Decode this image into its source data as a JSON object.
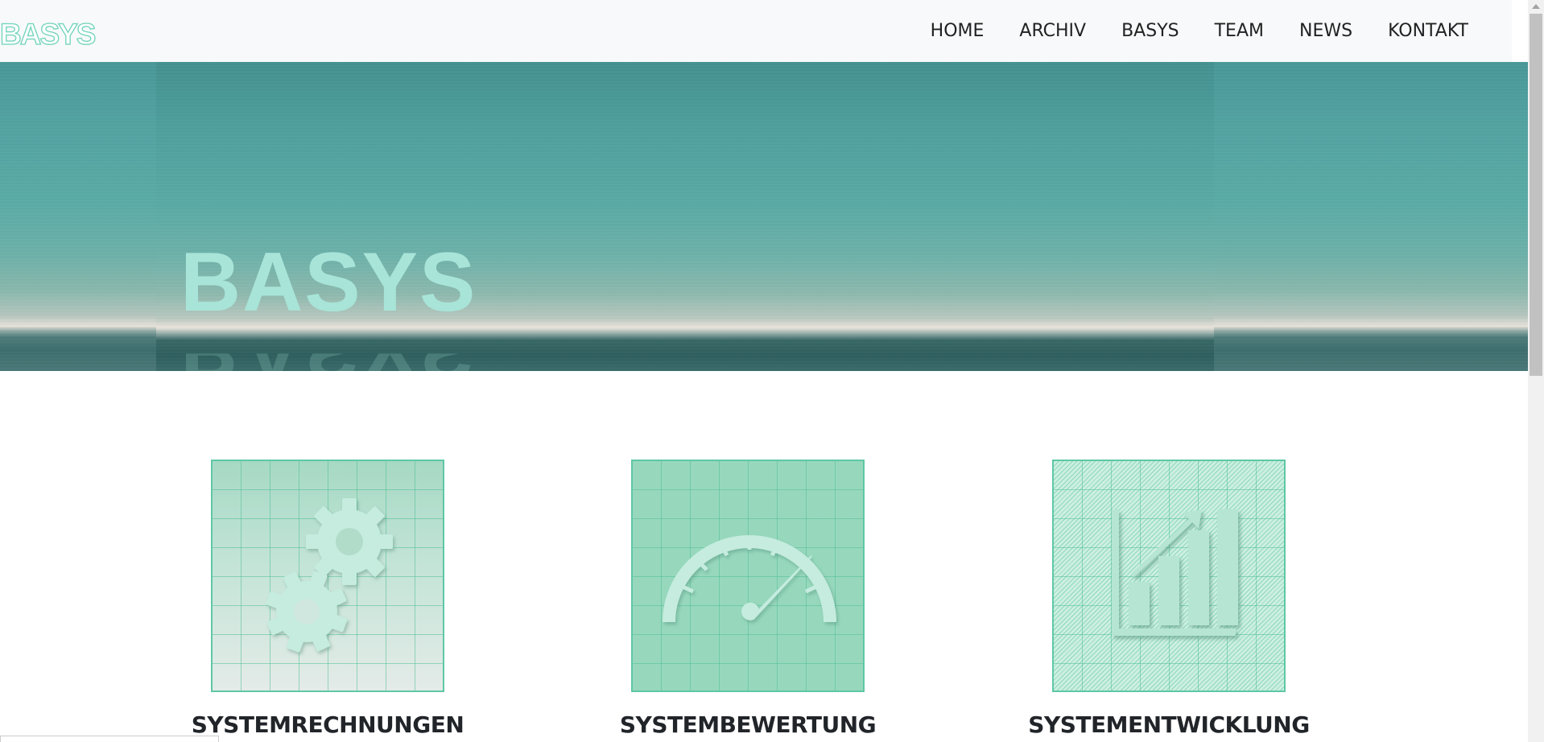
{
  "brand": {
    "logo_text": "BASYS"
  },
  "nav": {
    "items": [
      {
        "label": "HOME"
      },
      {
        "label": "ARCHIV"
      },
      {
        "label": "BASYS"
      },
      {
        "label": "TEAM"
      },
      {
        "label": "NEWS"
      },
      {
        "label": "KONTAKT"
      }
    ]
  },
  "hero": {
    "title": "BASYS"
  },
  "services": [
    {
      "title": "SYSTEMRECHNUNGEN",
      "icon": "gears-icon"
    },
    {
      "title": "SYSTEMBEWERTUNG",
      "icon": "speedometer-icon"
    },
    {
      "title": "SYSTEMENTWICKLUNG",
      "icon": "growth-chart-icon"
    }
  ],
  "colors": {
    "accent": "#5fc7a6",
    "nav_bg": "#f8f9fa",
    "hero_teal": "#52a3a1",
    "hero_title": "#a8e4d8",
    "icon_fill": "#c5ecdf"
  }
}
